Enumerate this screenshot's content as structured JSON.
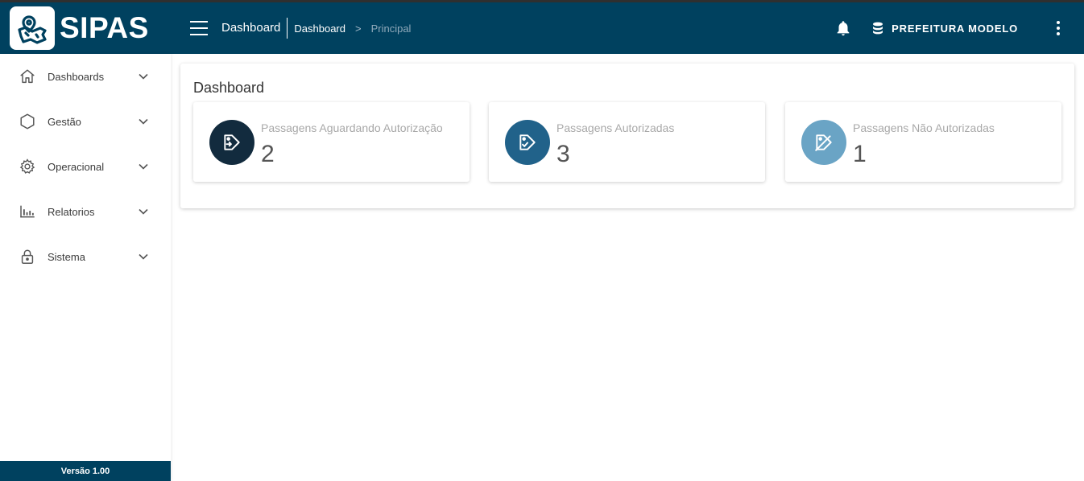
{
  "app": {
    "brand": "SIPAS"
  },
  "header": {
    "title": "Dashboard",
    "breadcrumb": {
      "current": "Dashboard",
      "separator": ">",
      "sub": "Principal"
    },
    "organization": "PREFEITURA MODELO"
  },
  "sidebar": {
    "items": [
      {
        "label": "Dashboards",
        "icon": "home-icon"
      },
      {
        "label": "Gestão",
        "icon": "hexagon-icon"
      },
      {
        "label": "Operacional",
        "icon": "gear-icon"
      },
      {
        "label": "Relatorios",
        "icon": "bar-chart-icon"
      },
      {
        "label": "Sistema",
        "icon": "lock-icon"
      }
    ],
    "version": "Versão 1.00"
  },
  "main": {
    "title": "Dashboard",
    "cards": [
      {
        "label": "Passagens Aguardando Autorização",
        "value": "2",
        "color": "#122b3e",
        "icon": "ticket-pending-icon"
      },
      {
        "label": "Passagens Autorizadas",
        "value": "3",
        "color": "#21628a",
        "icon": "ticket-check-icon"
      },
      {
        "label": "Passagens Não Autorizadas",
        "value": "1",
        "color": "#6aa4c5",
        "icon": "ticket-off-icon"
      }
    ]
  },
  "colors": {
    "primary": "#00415f",
    "accent_dark": "#122b3e",
    "accent_mid": "#21628a",
    "accent_light": "#6aa4c5"
  }
}
